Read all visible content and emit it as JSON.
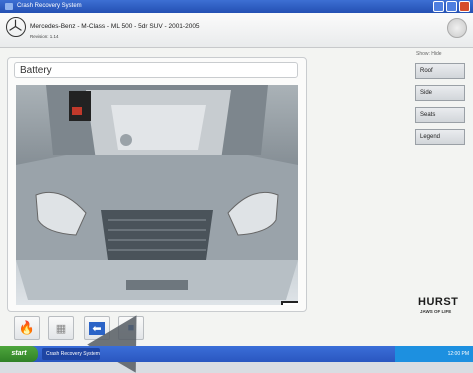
{
  "window": {
    "title": "Crash Recovery System"
  },
  "header": {
    "vehicle": "Mercedes-Benz - M-Class - ML 500 - 5dr SUV - 2001-2005",
    "revision": "Revision: 1.14"
  },
  "panel": {
    "title": "Battery"
  },
  "side": {
    "show_label": "Show: Hide",
    "buttons": [
      "Roof",
      "Side",
      "Seats",
      "Legend"
    ]
  },
  "branding": {
    "name": "HURST",
    "tagline": "JAWS OF LIFE"
  },
  "taskbar": {
    "start": "start",
    "task": "Crash Recovery System",
    "clock": "12:00 PM"
  }
}
